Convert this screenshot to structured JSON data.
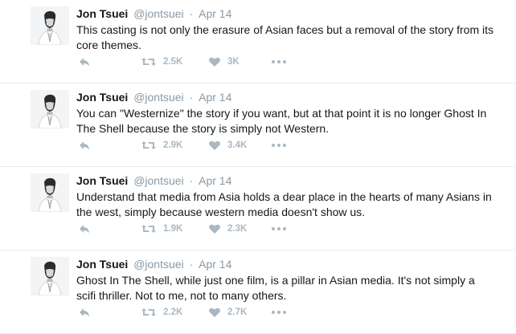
{
  "tweets": [
    {
      "name": "Jon Tsuei",
      "handle": "@jontsuei",
      "separator": "·",
      "date": "Apr 14",
      "text": "This casting is not only the erasure of Asian faces but a removal of the story from its core themes.",
      "retweets": "2.5K",
      "likes": "3K"
    },
    {
      "name": "Jon Tsuei",
      "handle": "@jontsuei",
      "separator": "·",
      "date": "Apr 14",
      "text": "You can \"Westernize\" the story if you want, but at that point it is no longer Ghost In The Shell because the story is simply not Western.",
      "retweets": "2.9K",
      "likes": "3.4K"
    },
    {
      "name": "Jon Tsuei",
      "handle": "@jontsuei",
      "separator": "·",
      "date": "Apr 14",
      "text": "Understand that media from Asia holds a dear place in the hearts of many Asians in the west, simply because western media doesn't show us.",
      "retweets": "1.9K",
      "likes": "2.3K"
    },
    {
      "name": "Jon Tsuei",
      "handle": "@jontsuei",
      "separator": "·",
      "date": "Apr 14",
      "text": "Ghost In The Shell, while just one film, is a pillar in Asian media. It's not simply a scifi thriller. Not to me, not to many others.",
      "retweets": "2.2K",
      "likes": "2.7K"
    }
  ],
  "icons": {
    "reply": "reply-icon",
    "retweet": "retweet-icon",
    "like": "heart-icon",
    "more": "more-dots-icon",
    "avatar": "avatar"
  },
  "colors": {
    "text": "#14171a",
    "meta": "#8899a6",
    "action": "#aab8c2",
    "divider": "#e6ecf0"
  }
}
